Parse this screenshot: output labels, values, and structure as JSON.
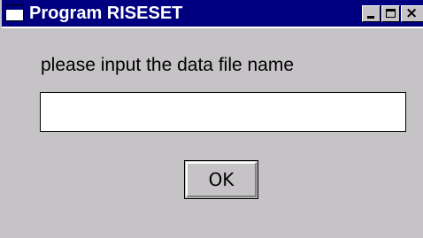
{
  "window": {
    "title": "Program RISESET",
    "controls": {
      "minimize_icon": "minimize-icon",
      "maximize_icon": "maximize-icon",
      "close_icon": "close-icon",
      "close_glyph": "×"
    }
  },
  "form": {
    "prompt": "please input the data file name",
    "filename_value": "",
    "ok_label": "OK"
  },
  "colors": {
    "titlebar": "#000080",
    "window_bg": "#c6c3c6",
    "input_bg": "#ffffff"
  }
}
